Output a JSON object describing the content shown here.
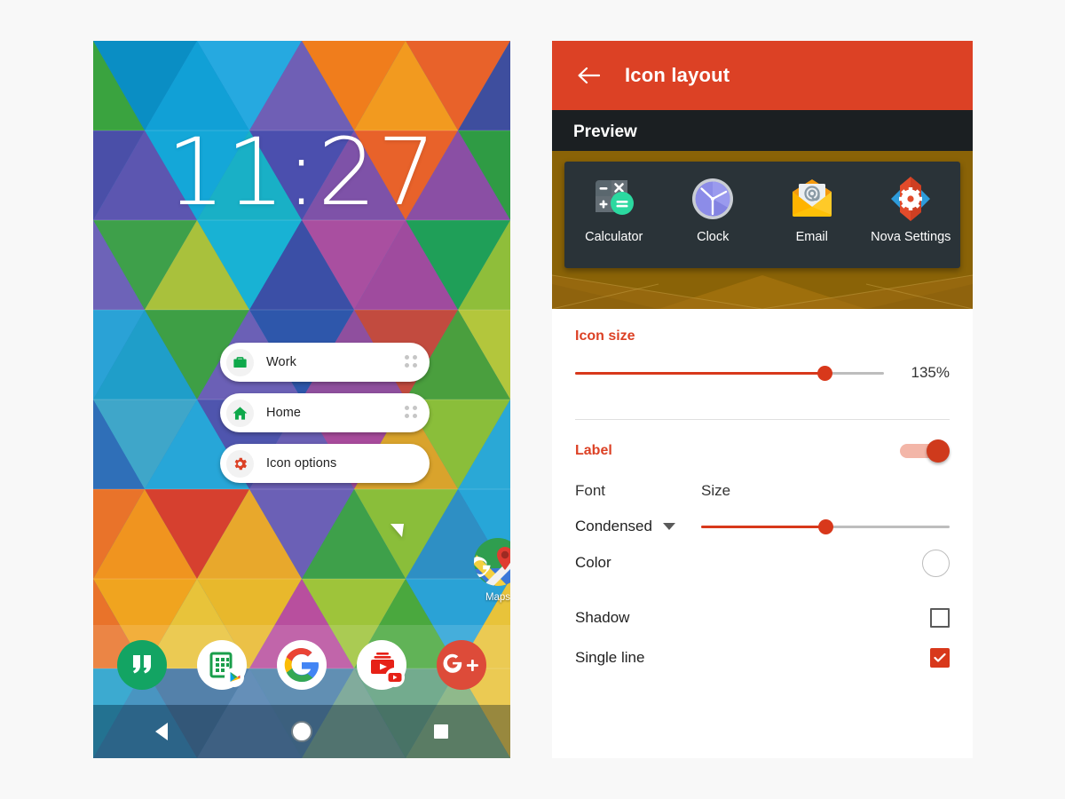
{
  "colors": {
    "accent": "#dc4125",
    "slider": "#d8381b",
    "page_bg": "#f8f8f8",
    "preview_card": "#2a3338",
    "preview_wall": "#8a6307"
  },
  "phone": {
    "clock": "11:27",
    "popup": {
      "items": [
        {
          "label": "Work",
          "icon": "briefcase-icon",
          "has_drag_handle": true
        },
        {
          "label": "Home",
          "icon": "house-icon",
          "has_drag_handle": true
        },
        {
          "label": "Icon options",
          "icon": "gear-icon",
          "has_drag_handle": false
        }
      ]
    },
    "app_icon": {
      "label": "Maps",
      "icon": "google-maps-icon"
    },
    "drawer_indicator": "chevron-up-icon",
    "dock": [
      {
        "name": "Hangouts",
        "icon": "hangouts-icon"
      },
      {
        "name": "Sheets",
        "icon": "sheets-play-icon"
      },
      {
        "name": "Google",
        "icon": "google-g-icon"
      },
      {
        "name": "YouTube",
        "icon": "youtube-play-icon"
      },
      {
        "name": "Google Plus",
        "icon": "google-plus-icon"
      }
    ],
    "navbar": [
      {
        "name": "Back",
        "icon": "back-triangle-icon"
      },
      {
        "name": "Home",
        "icon": "home-circle-icon"
      },
      {
        "name": "Recents",
        "icon": "recents-square-icon"
      }
    ]
  },
  "panel": {
    "appbar": {
      "back_icon": "arrow-left-icon",
      "title": "Icon layout"
    },
    "preview": {
      "header": "Preview",
      "items": [
        {
          "label": "Calculator",
          "icon": "calculator-icon"
        },
        {
          "label": "Clock",
          "icon": "clock-icon"
        },
        {
          "label": "Email",
          "icon": "email-icon"
        },
        {
          "label": "Nova Settings",
          "icon": "nova-settings-icon"
        }
      ]
    },
    "icon_size": {
      "title": "Icon size",
      "value_text": "135%",
      "slider_percent": 81
    },
    "label": {
      "title": "Label",
      "toggle_on": true,
      "font_header": "Font",
      "size_header": "Size",
      "font_value": "Condensed",
      "font_caret": "chevron-down-icon",
      "size_slider_percent": 50
    },
    "options": [
      {
        "label": "Color",
        "control": "color-swatch",
        "value": "#ffffff"
      },
      {
        "label": "Shadow",
        "control": "checkbox",
        "checked": false
      },
      {
        "label": "Single line",
        "control": "checkbox",
        "checked": true
      }
    ]
  }
}
